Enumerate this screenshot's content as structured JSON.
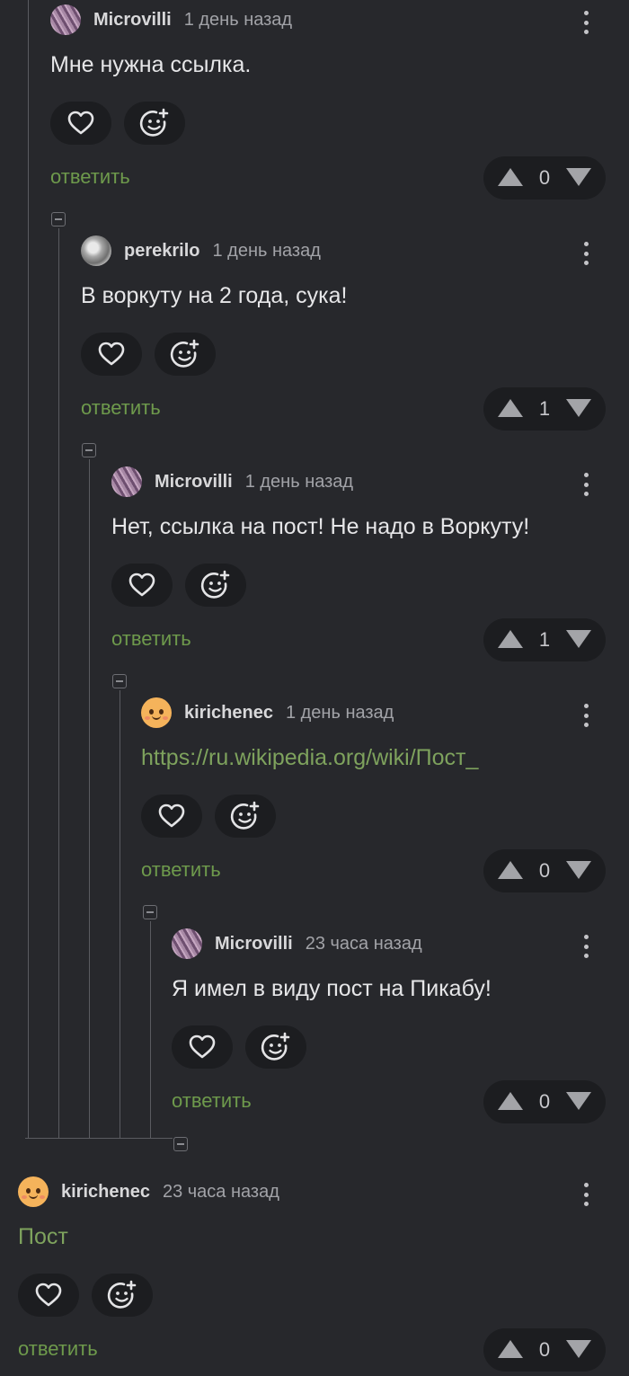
{
  "comments": [
    {
      "username": "Microvilli",
      "time": "1 день назад",
      "avatar": "purple",
      "text": "Мне нужна ссылка.",
      "reply_label": "ответить",
      "rating": "0"
    },
    {
      "username": "perekrilo",
      "time": "1 день назад",
      "avatar": "gray",
      "text": "В воркуту на 2 года, сука!",
      "reply_label": "ответить",
      "rating": "1"
    },
    {
      "username": "Microvilli",
      "time": "1 день назад",
      "avatar": "purple",
      "text": "Нет, ссылка на пост! Не надо в Воркуту!",
      "reply_label": "ответить",
      "rating": "1"
    },
    {
      "username": "kirichenec",
      "time": "1 день назад",
      "avatar": "face",
      "text": "https://ru.wikipedia.org/wiki/Пост_",
      "reply_label": "ответить",
      "rating": "0"
    },
    {
      "username": "Microvilli",
      "time": "23 часа назад",
      "avatar": "purple",
      "text": "Я имел в виду пост на Пикабу!",
      "reply_label": "ответить",
      "rating": "0"
    },
    {
      "username": "kirichenec",
      "time": "23 часа назад",
      "avatar": "face",
      "text": "Пост",
      "reply_label": "ответить",
      "rating": "0"
    }
  ],
  "icons": {
    "like": "heart-outline-icon",
    "react": "add-emoji-icon",
    "more": "more-vertical-icon",
    "upvote": "triangle-up-icon",
    "downvote": "triangle-down-icon",
    "collapse": "minus-square-icon"
  },
  "colors": {
    "background": "#27282c",
    "pill": "#1c1d20",
    "accent_green": "#6e9a4c",
    "link_green": "#7ea25d"
  }
}
